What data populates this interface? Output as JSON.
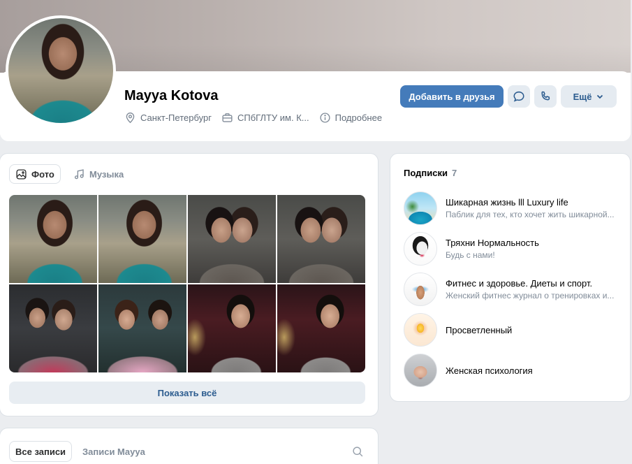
{
  "profile": {
    "name": "Mayya Kotova",
    "city": "Санкт-Петербург",
    "education": "СПбГЛТУ им. К...",
    "details_link": "Подробнее",
    "icons": {
      "city": "location-pin-icon",
      "education": "briefcase-icon",
      "details": "info-icon"
    }
  },
  "actions": {
    "add_friend": "Добавить в друзья",
    "message_icon": "message-bubble-icon",
    "call_icon": "phone-icon",
    "more": "Ещё"
  },
  "media": {
    "tabs": [
      {
        "label": "Фото",
        "icon": "photo-icon",
        "active": true
      },
      {
        "label": "Музыка",
        "icon": "music-note-icon",
        "active": false
      }
    ],
    "show_all": "Показать всё"
  },
  "subscriptions": {
    "title": "Подписки",
    "count": "7",
    "items": [
      {
        "title": "Шикарная жизнь lll Luxury life",
        "description": "Паблик для тех, кто хочет жить шикарной..."
      },
      {
        "title": "Тряхни Нормальность",
        "description": "Будь с нами!"
      },
      {
        "title": "Фитнес и здоровье. Диеты и спорт.",
        "description": "Женский фитнес журнал о тренировках и..."
      },
      {
        "title": "Просветленный",
        "description": ""
      },
      {
        "title": "Женская психология",
        "description": ""
      }
    ]
  },
  "wall": {
    "tab_all": "Все записи",
    "tab_user": "Записи Mayya",
    "search_icon": "search-icon"
  },
  "colors": {
    "accent": "#447bba",
    "secondary_button": "#e5ebf1",
    "link": "#2c5c8f",
    "muted_text": "#818c99",
    "background": "#ebedf0"
  }
}
